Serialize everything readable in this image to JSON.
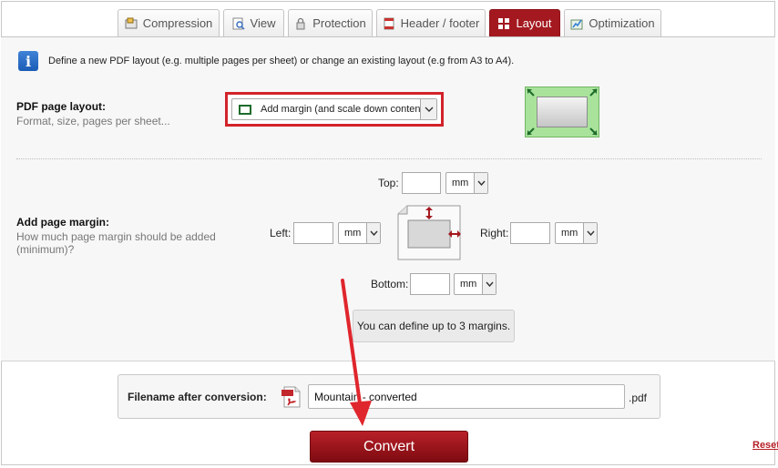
{
  "tabs": [
    {
      "label": "Compression",
      "icon": "compression-icon"
    },
    {
      "label": "View",
      "icon": "view-icon"
    },
    {
      "label": "Protection",
      "icon": "protection-icon"
    },
    {
      "label": "Header / footer",
      "icon": "header-footer-icon"
    },
    {
      "label": "Layout",
      "icon": "layout-icon",
      "active": true
    },
    {
      "label": "Optimization",
      "icon": "optimization-icon"
    }
  ],
  "info": {
    "icon": "info-icon",
    "text": "Define a new PDF layout (e.g. multiple pages per sheet) or change an existing layout (e.g from A3 to A4)."
  },
  "layout_section": {
    "label": "PDF page layout:",
    "sublabel": "Format, size, pages per sheet...",
    "selected": "Add margin (and scale down content)"
  },
  "margin_section": {
    "label": "Add page margin:",
    "sublabel_line1": "How much page margin should be added",
    "sublabel_line2": "(minimum)?",
    "top_label": "Top:",
    "left_label": "Left:",
    "right_label": "Right:",
    "bottom_label": "Bottom:",
    "top_value": "",
    "left_value": "",
    "right_value": "",
    "bottom_value": "",
    "unit": "mm",
    "hint": "You can define up to 3 margins."
  },
  "filename": {
    "label": "Filename after conversion:",
    "value": "Mountain - converted",
    "extension": ".pdf"
  },
  "convert_label": "Convert",
  "reset_label": "Reset",
  "colors": {
    "accent": "#a41920",
    "highlight": "#d2232a",
    "preview_green": "#a9e39b"
  }
}
